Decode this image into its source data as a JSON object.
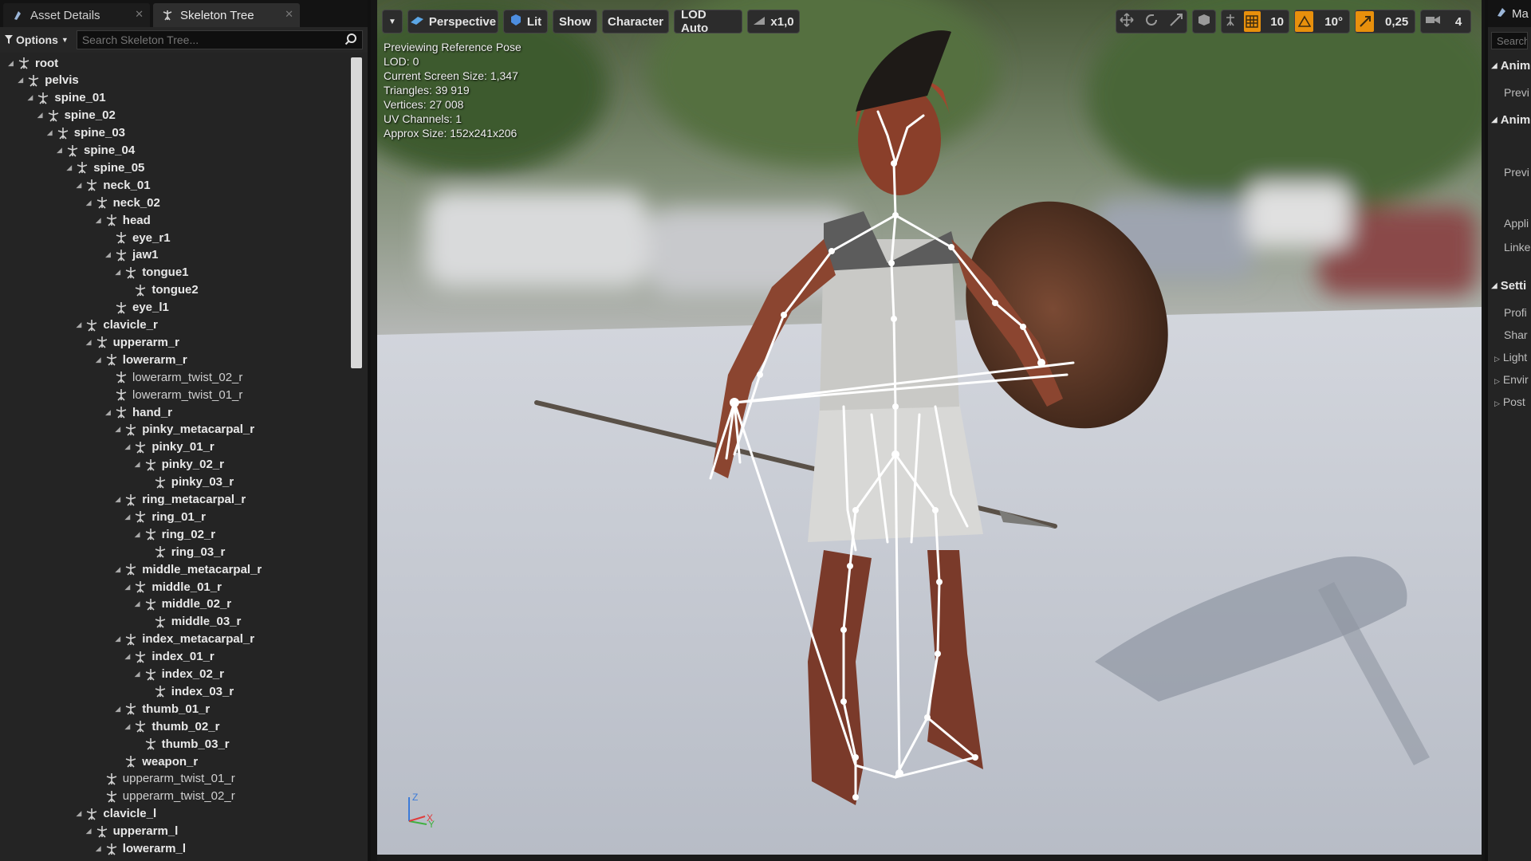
{
  "tabs": [
    {
      "label": "Asset Details",
      "active": false
    },
    {
      "label": "Skeleton Tree",
      "active": true
    }
  ],
  "toolbar": {
    "options_label": "Options",
    "search_placeholder": "Search Skeleton Tree..."
  },
  "tree": [
    {
      "name": "root",
      "depth": 0,
      "expanded": true,
      "twist": false
    },
    {
      "name": "pelvis",
      "depth": 1,
      "expanded": true,
      "twist": false
    },
    {
      "name": "spine_01",
      "depth": 2,
      "expanded": true,
      "twist": false
    },
    {
      "name": "spine_02",
      "depth": 3,
      "expanded": true,
      "twist": false
    },
    {
      "name": "spine_03",
      "depth": 4,
      "expanded": true,
      "twist": false
    },
    {
      "name": "spine_04",
      "depth": 5,
      "expanded": true,
      "twist": false
    },
    {
      "name": "spine_05",
      "depth": 6,
      "expanded": true,
      "twist": false
    },
    {
      "name": "neck_01",
      "depth": 7,
      "expanded": true,
      "twist": false
    },
    {
      "name": "neck_02",
      "depth": 8,
      "expanded": true,
      "twist": false
    },
    {
      "name": "head",
      "depth": 9,
      "expanded": true,
      "twist": false
    },
    {
      "name": "eye_r1",
      "depth": 10,
      "expanded": false,
      "twist": false
    },
    {
      "name": "jaw1",
      "depth": 10,
      "expanded": true,
      "twist": false
    },
    {
      "name": "tongue1",
      "depth": 11,
      "expanded": true,
      "twist": false
    },
    {
      "name": "tongue2",
      "depth": 12,
      "expanded": false,
      "twist": false
    },
    {
      "name": "eye_l1",
      "depth": 10,
      "expanded": false,
      "twist": false
    },
    {
      "name": "clavicle_r",
      "depth": 7,
      "expanded": true,
      "twist": false
    },
    {
      "name": "upperarm_r",
      "depth": 8,
      "expanded": true,
      "twist": false
    },
    {
      "name": "lowerarm_r",
      "depth": 9,
      "expanded": true,
      "twist": false
    },
    {
      "name": "lowerarm_twist_02_r",
      "depth": 10,
      "expanded": false,
      "twist": true
    },
    {
      "name": "lowerarm_twist_01_r",
      "depth": 10,
      "expanded": false,
      "twist": true
    },
    {
      "name": "hand_r",
      "depth": 10,
      "expanded": true,
      "twist": false
    },
    {
      "name": "pinky_metacarpal_r",
      "depth": 11,
      "expanded": true,
      "twist": false
    },
    {
      "name": "pinky_01_r",
      "depth": 12,
      "expanded": true,
      "twist": false
    },
    {
      "name": "pinky_02_r",
      "depth": 13,
      "expanded": true,
      "twist": false
    },
    {
      "name": "pinky_03_r",
      "depth": 14,
      "expanded": false,
      "twist": false
    },
    {
      "name": "ring_metacarpal_r",
      "depth": 11,
      "expanded": true,
      "twist": false
    },
    {
      "name": "ring_01_r",
      "depth": 12,
      "expanded": true,
      "twist": false
    },
    {
      "name": "ring_02_r",
      "depth": 13,
      "expanded": true,
      "twist": false
    },
    {
      "name": "ring_03_r",
      "depth": 14,
      "expanded": false,
      "twist": false
    },
    {
      "name": "middle_metacarpal_r",
      "depth": 11,
      "expanded": true,
      "twist": false
    },
    {
      "name": "middle_01_r",
      "depth": 12,
      "expanded": true,
      "twist": false
    },
    {
      "name": "middle_02_r",
      "depth": 13,
      "expanded": true,
      "twist": false
    },
    {
      "name": "middle_03_r",
      "depth": 14,
      "expanded": false,
      "twist": false
    },
    {
      "name": "index_metacarpal_r",
      "depth": 11,
      "expanded": true,
      "twist": false
    },
    {
      "name": "index_01_r",
      "depth": 12,
      "expanded": true,
      "twist": false
    },
    {
      "name": "index_02_r",
      "depth": 13,
      "expanded": true,
      "twist": false
    },
    {
      "name": "index_03_r",
      "depth": 14,
      "expanded": false,
      "twist": false
    },
    {
      "name": "thumb_01_r",
      "depth": 11,
      "expanded": true,
      "twist": false
    },
    {
      "name": "thumb_02_r",
      "depth": 12,
      "expanded": true,
      "twist": false
    },
    {
      "name": "thumb_03_r",
      "depth": 13,
      "expanded": false,
      "twist": false
    },
    {
      "name": "weapon_r",
      "depth": 11,
      "expanded": false,
      "twist": false
    },
    {
      "name": "upperarm_twist_01_r",
      "depth": 9,
      "expanded": false,
      "twist": true
    },
    {
      "name": "upperarm_twist_02_r",
      "depth": 9,
      "expanded": false,
      "twist": true
    },
    {
      "name": "clavicle_l",
      "depth": 7,
      "expanded": true,
      "twist": false
    },
    {
      "name": "upperarm_l",
      "depth": 8,
      "expanded": true,
      "twist": false
    },
    {
      "name": "lowerarm_l",
      "depth": 9,
      "expanded": true,
      "twist": false
    }
  ],
  "viewport": {
    "buttons": {
      "perspective": "Perspective",
      "lit": "Lit",
      "show": "Show",
      "character": "Character",
      "lod": "LOD Auto",
      "speed": "x1,0"
    },
    "right_buttons": {
      "grid_snap": "10",
      "rotation_snap": "10°",
      "scale_snap": "0,25",
      "camera_speed": "4"
    },
    "stats": [
      "Previewing Reference Pose",
      "LOD: 0",
      "Current Screen Size: 1,347",
      "Triangles: 39 919",
      "Vertices: 27 008",
      "UV Channels: 1",
      "Approx Size: 152x241x206"
    ],
    "axis_labels": {
      "z": "Z",
      "x": "X",
      "y": "Y"
    }
  },
  "right_panel": {
    "tab_label": "Ma",
    "search_placeholder": "Search",
    "sections": [
      "Anim",
      "Anim",
      "Setti"
    ],
    "items": [
      "Previ",
      "Previ",
      "Appli",
      "Linke",
      "Profi",
      "Shar"
    ],
    "subsections": [
      "Light",
      "Envir",
      "Post"
    ]
  },
  "colors": {
    "accent_orange": "#e8900c",
    "panel_bg": "#242424",
    "tab_bg": "#131313",
    "bone_white": "#ffffff"
  }
}
